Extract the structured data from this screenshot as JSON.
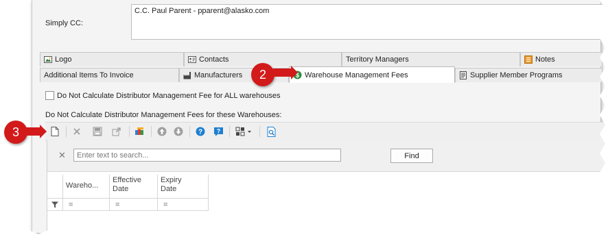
{
  "header": {
    "simply_cc_label": "Simply CC:",
    "simply_cc_value": "C.C. Paul Parent - pparent@alasko.com"
  },
  "tabs": {
    "row1": [
      {
        "label": "Logo",
        "icon": "image-icon"
      },
      {
        "label": "Contacts",
        "icon": "contact-card-icon"
      },
      {
        "label": "Territory Managers",
        "icon": ""
      },
      {
        "label": "Notes",
        "icon": "notes-icon"
      }
    ],
    "row2": [
      {
        "label": "Additional Items To Invoice",
        "icon": ""
      },
      {
        "label": "Manufacturers",
        "icon": "factory-icon"
      },
      {
        "label": "Warehouse Management Fees",
        "icon": "dollar-circle-icon",
        "active": true
      },
      {
        "label": "Supplier Member Programs",
        "icon": "document-icon"
      }
    ]
  },
  "options": {
    "all_warehouses_checkbox_label": "Do Not Calculate Distributor Management Fee for ALL warehouses",
    "all_warehouses_checked": false,
    "per_warehouse_label": "Do Not Calculate Distributor Management Fees for these Warehouses:"
  },
  "toolbar": {
    "buttons": [
      "new-icon",
      "delete-icon",
      "save-layout-icon",
      "export-icon",
      "color-theme-icon",
      "move-up-icon",
      "move-down-icon",
      "help-icon",
      "help-tooltip-icon",
      "layout-dropdown-icon",
      "print-preview-icon"
    ]
  },
  "grid": {
    "search_placeholder": "Enter text to search...",
    "find_label": "Find",
    "columns": [
      {
        "line1": "Wareho...",
        "line2": ""
      },
      {
        "line1": "Effective",
        "line2": "Date"
      },
      {
        "line1": "Expiry",
        "line2": "Date"
      }
    ],
    "filter_symbol": "="
  },
  "callouts": {
    "two": "2",
    "three": "3"
  },
  "colors": {
    "callout": "#d21a1a",
    "toolbar_blue": "#1e7fcf",
    "notes_orange": "#e89a2c",
    "dollar_green": "#2e8b3e"
  }
}
